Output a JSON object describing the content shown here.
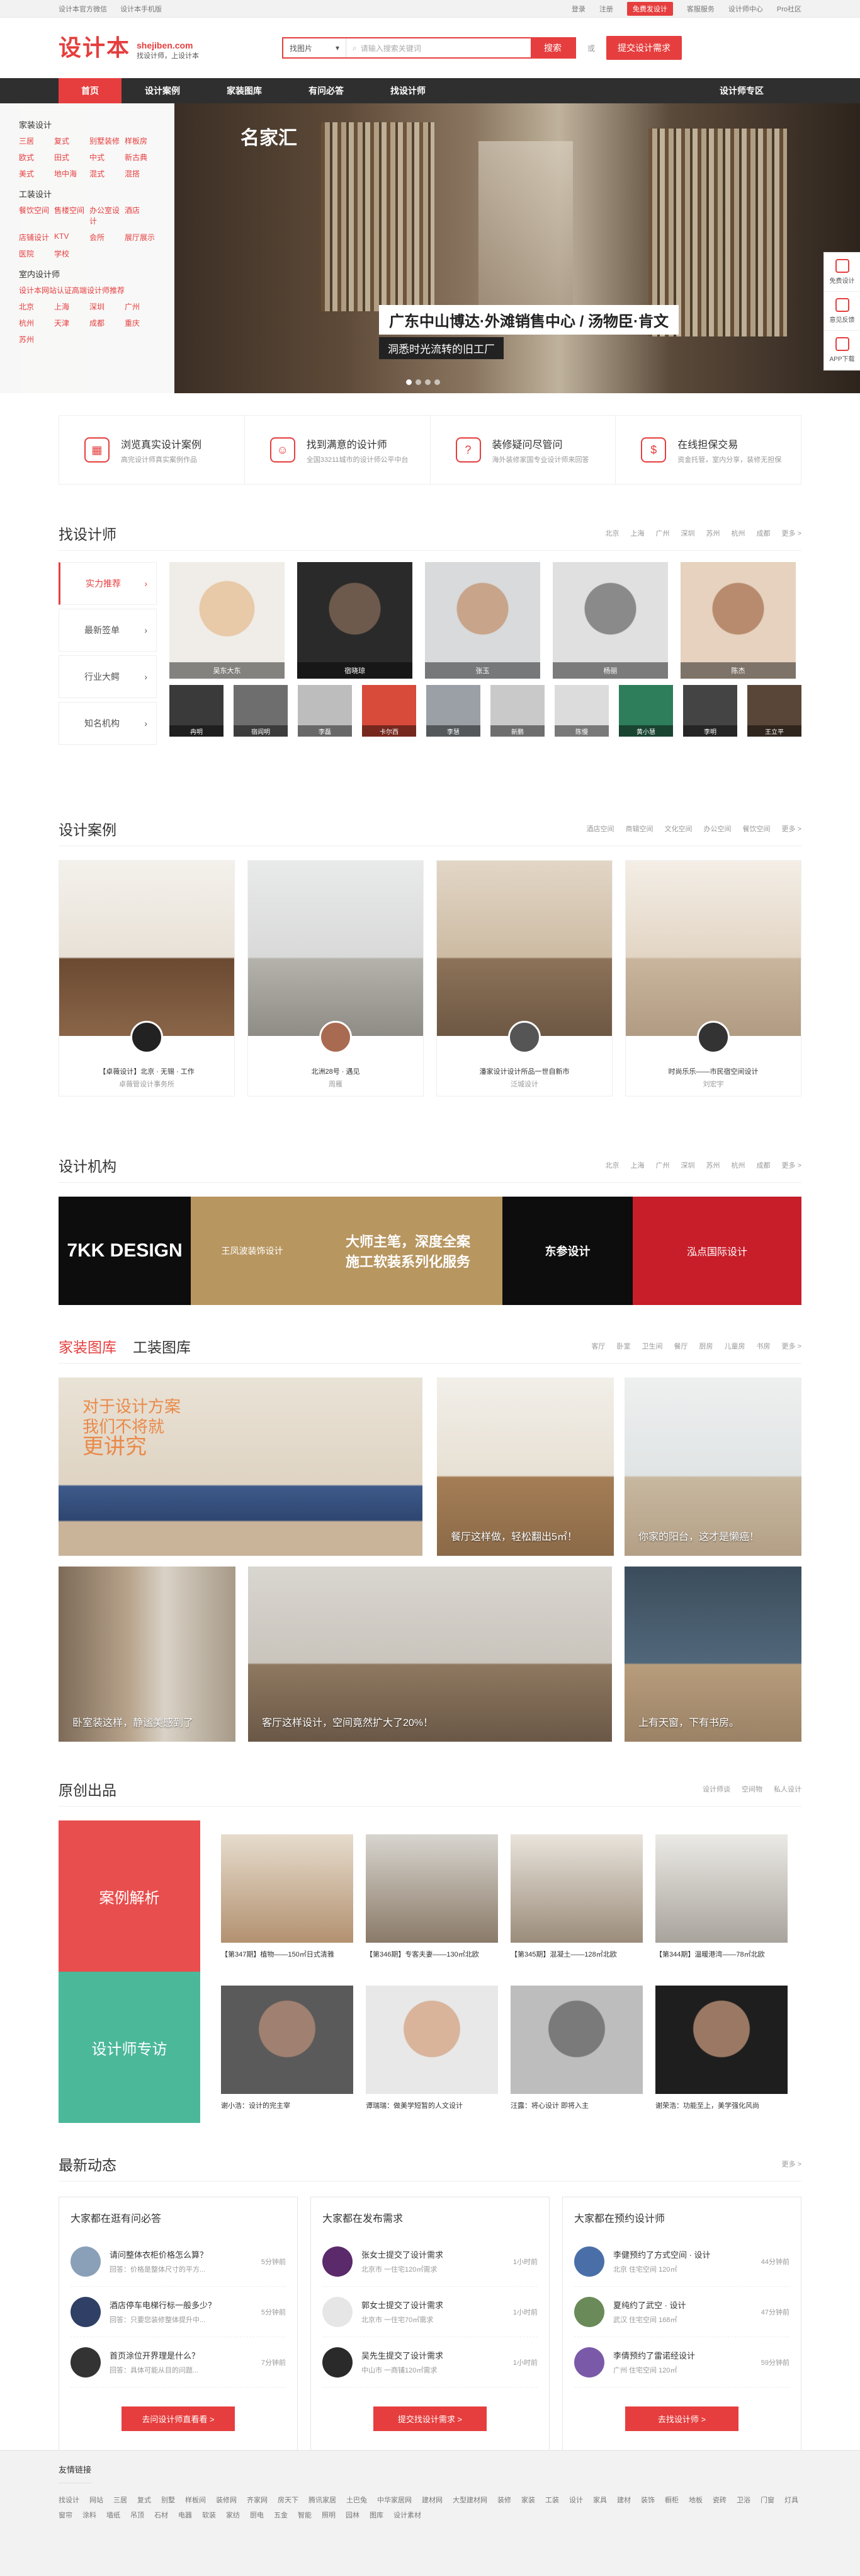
{
  "topbar": {
    "left": [
      "设计本官方微信",
      "设计本手机版"
    ],
    "right": [
      "登录",
      "注册",
      "免费发设计",
      "客服服务",
      "设计师中心",
      "Pro社区"
    ]
  },
  "header": {
    "logo_cn": "设计本",
    "logo_domain": "shejiben.com",
    "slogan": "找设计师，上设计本",
    "search_type": "找图片",
    "search_placeholder": "请输入搜索关键词",
    "search_btn": "搜索",
    "or": "或",
    "submit": "提交设计需求"
  },
  "nav": {
    "items": [
      "首页",
      "设计案例",
      "家装图库",
      "有问必答",
      "找设计师"
    ],
    "zone": "设计师专区"
  },
  "menu": {
    "g1": {
      "title": "家装设计",
      "items": [
        "三居",
        "复式",
        "别墅装修",
        "样板房",
        "欧式",
        "田式",
        "中式",
        "新古典",
        "美式",
        "地中海",
        "混式",
        "混搭"
      ]
    },
    "g2": {
      "title": "工装设计",
      "items": [
        "餐饮空间",
        "售楼空间",
        "办公室设计",
        "酒店",
        "店铺设计",
        "KTV",
        "会所",
        "展厅展示",
        "医院",
        "学校"
      ]
    },
    "g3": {
      "title": "室内设计师",
      "items": [
        "设计本网站认证高端设计师推荐",
        "北京",
        "上海",
        "深圳",
        "广州",
        "杭州",
        "天津",
        "成都",
        "重庆",
        "苏州"
      ]
    }
  },
  "banner": {
    "brand": "名家汇",
    "title": "广东中山博达·外滩销售中心 / 汤物臣·肯文",
    "sub": "洞悉时光流转的旧工厂"
  },
  "side_float": [
    "免费设计",
    "意见反馈",
    "APP下载"
  ],
  "services": [
    {
      "t": "浏览真实设计案例",
      "d": "高完设计师真实案例作品"
    },
    {
      "t": "找到满意的设计师",
      "d": "全国33211城市的设计师公平中台"
    },
    {
      "t": "装修疑问尽管问",
      "d": "海外装修家国专业设计师来回答"
    },
    {
      "t": "在线担保交易",
      "d": "资金托管，室内分享，装修无担保"
    }
  ],
  "find": {
    "title": "找设计师",
    "cities": [
      "北京",
      "上海",
      "广州",
      "深圳",
      "苏州",
      "杭州",
      "成都",
      "更多 >"
    ],
    "tabs": [
      "实力推荐",
      "最新签单",
      "行业大鳄",
      "知名机构"
    ],
    "big": [
      "吴东大东",
      "宿晓琼",
      "张玉",
      "杨丽",
      "陈杰"
    ],
    "small": [
      "冉明",
      "宿阎明",
      "李磊",
      "卡尔西",
      "李慧",
      "新鹏",
      "陈慢",
      "黄小慧",
      "李明",
      "王立平"
    ]
  },
  "cases": {
    "title": "设计案例",
    "links": [
      "酒店空间",
      "商辑空间",
      "文化空间",
      "办公空间",
      "餐饮空间",
      "更多 >"
    ],
    "items": [
      {
        "t": "【卓薇设计】北京 · 无锡 · 工作",
        "a": "卓薇管设计事务所"
      },
      {
        "t": "北洲28号 · 遇见",
        "a": "周雁"
      },
      {
        "t": "潘家设计设计所品一世自新市",
        "a": "泛城设计"
      },
      {
        "t": "时尚乐乐——市民宿空间设计",
        "a": "刘宏宇"
      }
    ]
  },
  "orgs": {
    "title": "设计机构",
    "cities": [
      "北京",
      "上海",
      "广州",
      "深圳",
      "苏州",
      "杭州",
      "成都",
      "更多 >"
    ],
    "names": [
      "7KK DESIGN",
      "王凤波装饰设计",
      "大师主笔，深度全案",
      "施工软装系列化服务",
      "东参设计",
      "泓点国际设计"
    ]
  },
  "gallery": {
    "tabs": [
      "家装图库",
      "工装图库"
    ],
    "links": [
      "客厅",
      "卧室",
      "卫生间",
      "餐厅",
      "厨房",
      "儿童房",
      "书房",
      "更多 >"
    ],
    "slogan": [
      "对于设计方案",
      "我们不将就",
      "更讲究"
    ],
    "caps": [
      "餐厅这样做，轻松翻出5㎡！",
      "你家的阳台，这才是懒癌！",
      "卧室装这样，静谧美感到了",
      "客厅这样设计，空间竟然扩大了20%！",
      "上有天窗，下有书房。"
    ]
  },
  "original": {
    "title": "原创出品",
    "links": [
      "设计师谈",
      "空间物",
      "私人设计"
    ],
    "blocks": [
      "案例解析",
      "设计师专访"
    ],
    "cases": [
      "【第347期】植物——150㎡日式清雅",
      "【第346期】专客夫妻——130㎡北欧",
      "【第345期】混凝土——128㎡北欧",
      "【第344期】温暖港湾——78㎡北欧"
    ],
    "people": [
      "谢小浩：设计的完主宰",
      "谭瑞瑞：做美学短暂的人文设计",
      "汪露：将心设计 即将入主",
      "谢荣浩：功能至上，美学强化风尚"
    ]
  },
  "news": {
    "title": "最新动态",
    "more": "更多 >",
    "cols": [
      {
        "h": "大家都在逛有问必答",
        "items": [
          {
            "t": "请问整体衣柜价格怎么算？",
            "s": "回答：价格是整体尺寸的平方...",
            "m": "5分钟前"
          },
          {
            "t": "酒店停车电梯行标一般多少？",
            "s": "回答：只要您装修整体提升中...",
            "m": "5分钟前"
          },
          {
            "t": "首页涂位开界理是什么？",
            "s": "回答：具体可能从目的问题...",
            "m": "7分钟前"
          }
        ],
        "btn": "去问设计师直看看 >"
      },
      {
        "h": "大家都在发布需求",
        "items": [
          {
            "t": "张女士提交了设计需求",
            "s": "北京市 一住宅120㎡需求",
            "m": "1小时前"
          },
          {
            "t": "郭女士提交了设计需求",
            "s": "北京市 一住宅70㎡需求",
            "m": "1小时前"
          },
          {
            "t": "吴先生提交了设计需求",
            "s": "中山市 一商铺120㎡需求",
            "m": "1小时前"
          }
        ],
        "btn": "提交找设计需求 >"
      },
      {
        "h": "大家都在预约设计师",
        "items": [
          {
            "t": "李健预约了方式空间 · 设计",
            "s": "北京 住宅空间 120㎡",
            "m": "44分钟前"
          },
          {
            "t": "夏纯约了武空 · 设计",
            "s": "武汉 住宅空间 168㎡",
            "m": "47分钟前"
          },
          {
            "t": "李倩预约了雷诺经设计",
            "s": "广州 住宅空间 120㎡",
            "m": "59分钟前"
          }
        ],
        "btn": "去找设计师 >"
      }
    ]
  },
  "footer": {
    "title": "友情链接",
    "links": [
      "找设计",
      "网站",
      "三居",
      "复式",
      "别墅",
      "样板间",
      "装修网",
      "齐家网",
      "房天下",
      "腾讯家居",
      "土巴兔",
      "中华家居网",
      "建材网",
      "大型建材网",
      "装修",
      "家装",
      "工装",
      "设计",
      "家具",
      "建材",
      "装饰",
      "橱柜",
      "地板",
      "瓷砖",
      "卫浴",
      "门窗",
      "灯具",
      "窗帘",
      "涂料",
      "墙纸",
      "吊顶",
      "石材",
      "电器",
      "软装",
      "家纺",
      "厨电",
      "五金",
      "智能",
      "照明",
      "园林",
      "图库",
      "设计素材"
    ]
  }
}
